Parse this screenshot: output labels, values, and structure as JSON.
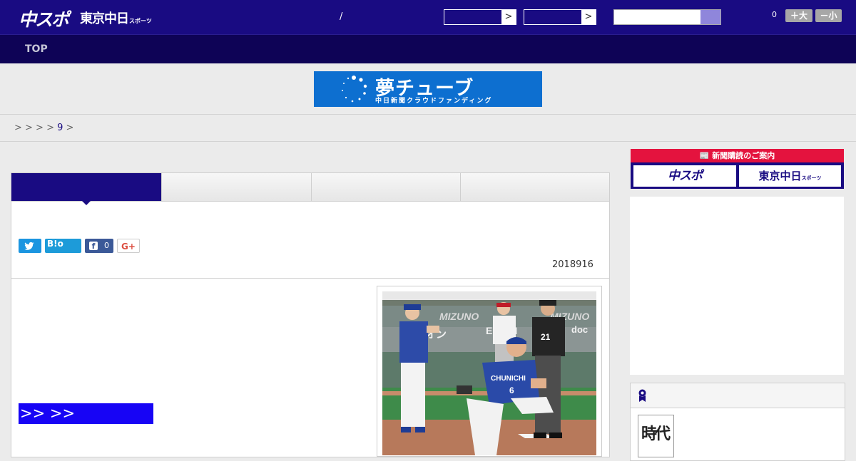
{
  "header": {
    "logo_main": "中スポ",
    "logo_tokyo": "東京中日",
    "logo_tokyo_small": "スポーツ",
    "slash": "/",
    "select_arrow": ">",
    "font_count": "0",
    "font_larger_label": "＋大",
    "font_smaller_label": "－小"
  },
  "nav": {
    "top_label": "TOP"
  },
  "banner": {
    "title": "夢チューブ",
    "subtitle": "中日新聞クラウドファンディング"
  },
  "breadcrumb": {
    "prefix": "> > > > ",
    "link": "9",
    "suffix": " >"
  },
  "article": {
    "share_twitter_icon": "twitter-icon",
    "share_hatena_label": "B!o",
    "share_facebook_f": "f",
    "share_facebook_count": "0",
    "share_gplus_label": "G+",
    "date": "2018916",
    "more_link": ">> >>"
  },
  "sidebar": {
    "subscribe_head": "新聞購読のご案内",
    "subscribe_a": "中スポ",
    "subscribe_b": "東京中日",
    "subscribe_b_small": "スポーツ",
    "book_thumb_text": "時代"
  },
  "colors": {
    "header_bg": "#190b82",
    "nav_bg": "#0e0356",
    "banner_bg": "#0d6fd0",
    "link_blue": "#1704f5",
    "subscribe_red": "#e4133e"
  }
}
